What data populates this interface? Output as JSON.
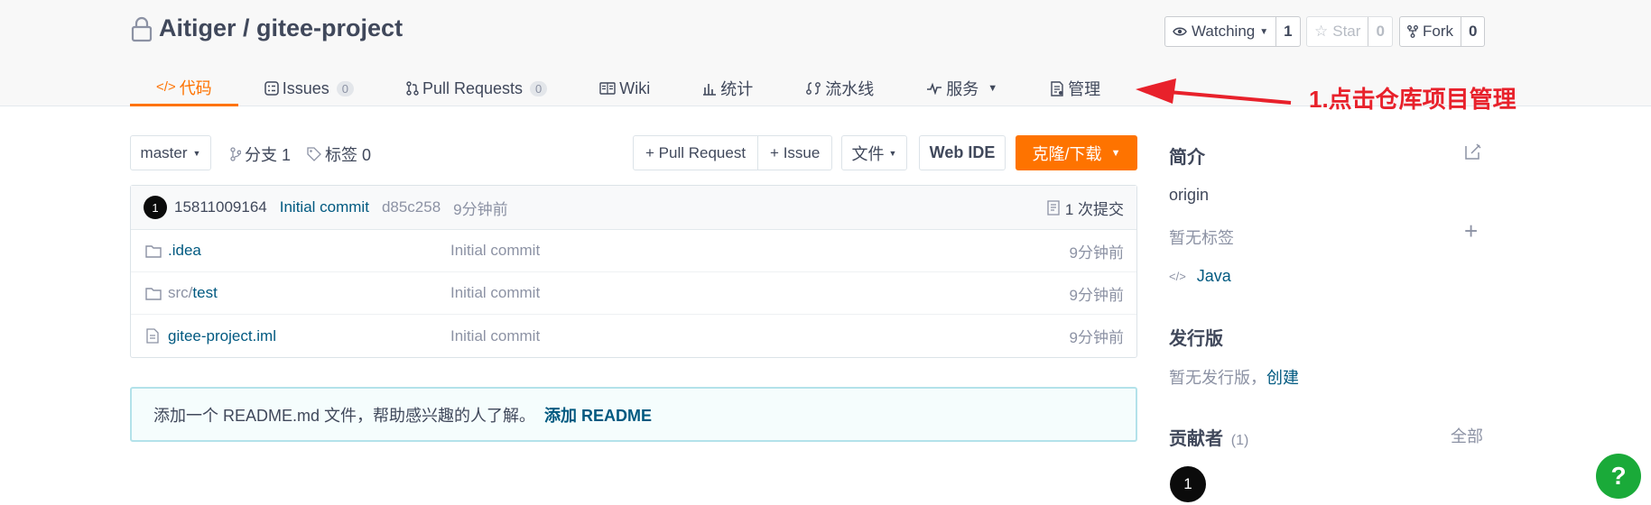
{
  "repo": {
    "owner": "Aitiger",
    "separator": " / ",
    "name": "gitee-project"
  },
  "header_actions": {
    "watch": {
      "label": "Watching",
      "count": "1"
    },
    "star": {
      "label": "Star",
      "count": "0"
    },
    "fork": {
      "label": "Fork",
      "count": "0"
    }
  },
  "tabs": [
    {
      "label": "代码",
      "icon": "code-icon",
      "active": true
    },
    {
      "label": "Issues",
      "icon": "issues-icon",
      "count": "0"
    },
    {
      "label": "Pull Requests",
      "icon": "pull-request-icon",
      "count": "0"
    },
    {
      "label": "Wiki",
      "icon": "wiki-icon"
    },
    {
      "label": "统计",
      "icon": "stats-icon"
    },
    {
      "label": "流水线",
      "icon": "pipeline-icon"
    },
    {
      "label": "服务",
      "icon": "service-icon"
    },
    {
      "label": "管理",
      "icon": "manage-icon"
    }
  ],
  "annotation": {
    "text": "1.点击仓库项目管理",
    "color": "#e8212b"
  },
  "toolbar": {
    "branch": "master",
    "branches": "分支 1",
    "tags": "标签 0",
    "pull_request": "+ Pull Request",
    "issue": "+ Issue",
    "file": "文件",
    "web_ide": "Web IDE",
    "clone": "克隆/下载"
  },
  "commit": {
    "avatar": "1",
    "author": "15811009164",
    "message": "Initial commit",
    "hash": "d85c258",
    "time": "9分钟前",
    "count_label": "1 次提交"
  },
  "files": [
    {
      "prefix": "",
      "name": ".idea",
      "icon": "folder-icon",
      "message": "Initial commit",
      "time": "9分钟前"
    },
    {
      "prefix": "src/",
      "name": "test",
      "icon": "folder-icon",
      "message": "Initial commit",
      "time": "9分钟前"
    },
    {
      "prefix": "",
      "name": "gitee-project.iml",
      "icon": "file-icon",
      "message": "Initial commit",
      "time": "9分钟前"
    }
  ],
  "readme": {
    "text": "添加一个 README.md 文件，帮助感兴趣的人了解。",
    "link": "添加 README"
  },
  "sidebar": {
    "intro_title": "简介",
    "description": "origin",
    "no_tags": "暂无标签",
    "language": "Java",
    "release_title": "发行版",
    "no_release": "暂无发行版，",
    "create": "创建",
    "contributors_title": "贡献者",
    "contributors_count": "(1)",
    "all": "全部",
    "contributor_avatar": "1"
  },
  "help": "?",
  "colors": {
    "accent": "#fe7300",
    "link": "#005980",
    "help": "#1aaa39"
  }
}
